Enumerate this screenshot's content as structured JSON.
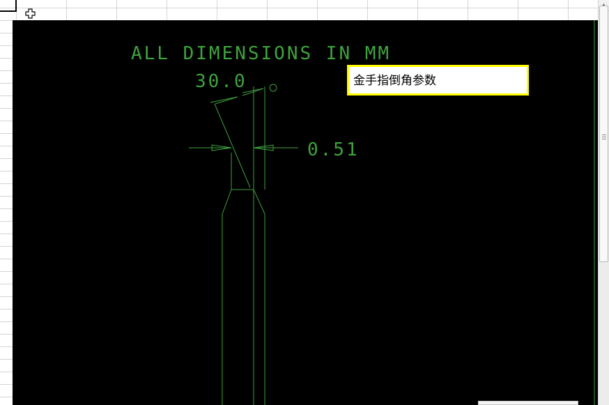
{
  "drawing": {
    "heading": "ALL DIMENSIONS IN MM",
    "angle_label": "30.0",
    "width_label": "0.51",
    "line_color": "#3ea33e",
    "background_color": "#000000"
  },
  "comment": {
    "text": "金手指倒角参数",
    "border_color": "#ffff00"
  },
  "icons": {
    "cursor": "plus-cursor-icon",
    "scroll_up": "arrow-up-icon"
  }
}
